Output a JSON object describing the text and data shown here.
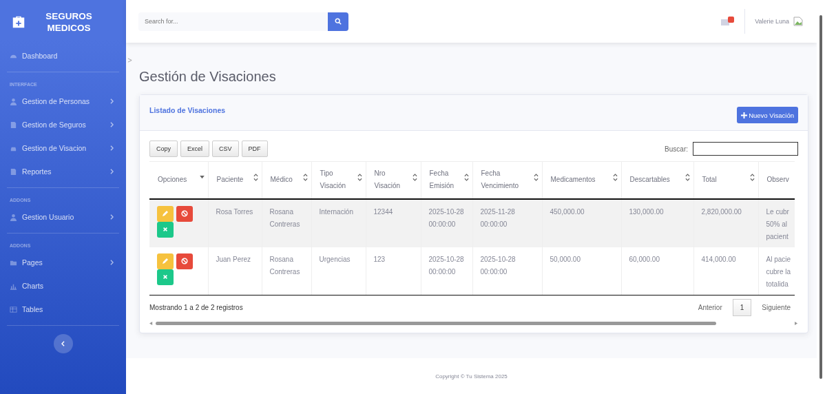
{
  "sidebar": {
    "brand": "SEGUROS MEDICOS",
    "sections": [
      {
        "items": [
          {
            "label": "Dashboard",
            "collapsible": false
          }
        ]
      },
      {
        "heading": "INTERFACE",
        "items": [
          {
            "label": "Gestion de Personas",
            "collapsible": true
          },
          {
            "label": "Gestion de Seguros",
            "collapsible": true
          },
          {
            "label": "Gestion de Visacion",
            "collapsible": true
          },
          {
            "label": "Reportes",
            "collapsible": true
          }
        ]
      },
      {
        "heading": "ADDONS",
        "items": [
          {
            "label": "Gestion Usuario",
            "collapsible": true
          }
        ]
      },
      {
        "heading": "ADDONS",
        "items": [
          {
            "label": "Pages",
            "collapsible": true
          },
          {
            "label": "Charts",
            "collapsible": false
          },
          {
            "label": "Tables",
            "collapsible": false
          }
        ]
      }
    ]
  },
  "topbar": {
    "search": {
      "placeholder": "Search for..."
    },
    "user_name": "Valerie Luna"
  },
  "page_title": "Gestión de Visaciones",
  "card": {
    "title": "Listado de Visaciones",
    "new_button": "Nuevo Visación",
    "export_buttons": [
      "Copy",
      "Excel",
      "CSV",
      "PDF"
    ],
    "search_label": "Buscar:",
    "table": {
      "columns": [
        "Opciones",
        "Paciente",
        "Médico",
        "Tipo Visación",
        "Nro Visación",
        "Fecha Emisión",
        "Fecha Vencimiento",
        "Medicamentos",
        "Descartables",
        "Total",
        "Observ"
      ],
      "rows": [
        [
          "",
          "Rosa Torres",
          "Rosana Contreras",
          "Internación",
          "12344",
          "2025-10-28 00:00:00",
          "2025-11-28 00:00:00",
          "450,000.00",
          "130,000.00",
          "2,820,000.00",
          "Le cubr 50% al pacient"
        ],
        [
          "",
          "Juan Perez",
          "Rosana Contreras",
          "Urgencias",
          "123",
          "2025-10-28 00:00:00",
          "2025-10-28 00:00:00",
          "50,000.00",
          "60,000.00",
          "414,000.00",
          "Al pacie cubre la totalida"
        ]
      ]
    },
    "info": "Mostrando 1 a 2 de 2 registros",
    "pagination": [
      {
        "label": "Anterior",
        "selected": false
      },
      {
        "label": "1",
        "selected": true
      },
      {
        "label": "Siguiente",
        "selected": false
      }
    ]
  },
  "footer": "Copyright © Tu Sistema 2025"
}
